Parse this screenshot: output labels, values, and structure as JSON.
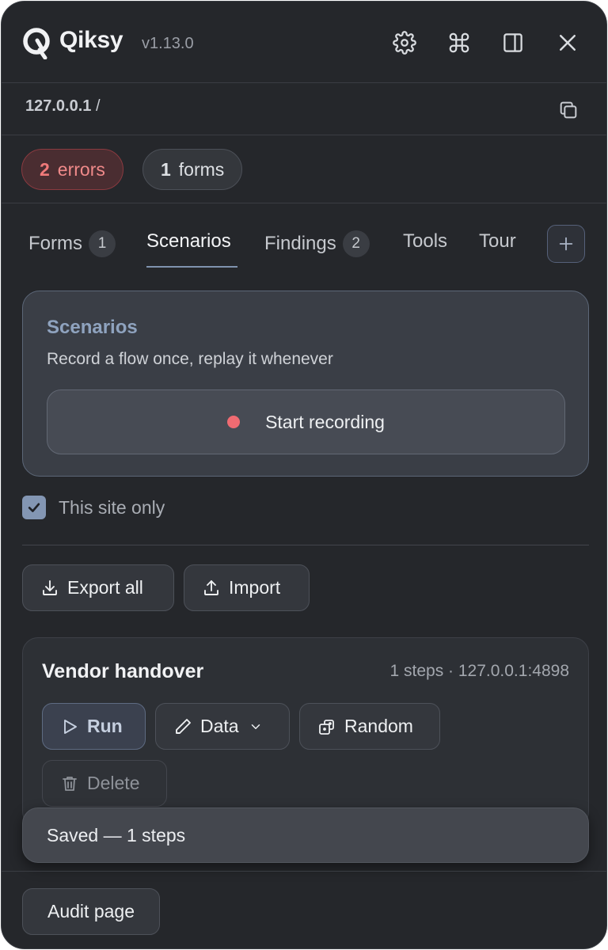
{
  "header": {
    "brand": "Qiksy",
    "version": "v1.13.0",
    "icons": [
      "settings-gear-icon",
      "command-icon",
      "sidebar-icon",
      "close-icon"
    ]
  },
  "url": {
    "host": "127.0.0.1",
    "path": "/"
  },
  "pills": {
    "errors": {
      "count": "2",
      "label": "errors"
    },
    "forms": {
      "count": "1",
      "label": "forms"
    }
  },
  "tabs": [
    {
      "label": "Forms",
      "count": "1"
    },
    {
      "label": "Scenarios"
    },
    {
      "label": "Findings",
      "count": "2"
    },
    {
      "label": "Tools"
    },
    {
      "label": "Tour"
    }
  ],
  "active_tab": "Scenarios",
  "scenarios_card": {
    "title": "Scenarios",
    "subtitle": "Record a flow once, replay it whenever",
    "record_button": "Start recording"
  },
  "site_only": {
    "label": "This site only",
    "checked": true
  },
  "actions": {
    "export": "Export all",
    "import": "Import"
  },
  "scenario_item": {
    "name": "Vendor handover",
    "meta": "1 steps · 127.0.0.1:4898",
    "run": "Run",
    "data": "Data",
    "random": "Random",
    "delete": "Delete"
  },
  "toast": "Saved — 1 steps",
  "footer": {
    "audit": "Audit page"
  },
  "colors": {
    "accent": "#8fa3bf",
    "error": "#f07a7a",
    "record_dot": "#f06b72"
  }
}
